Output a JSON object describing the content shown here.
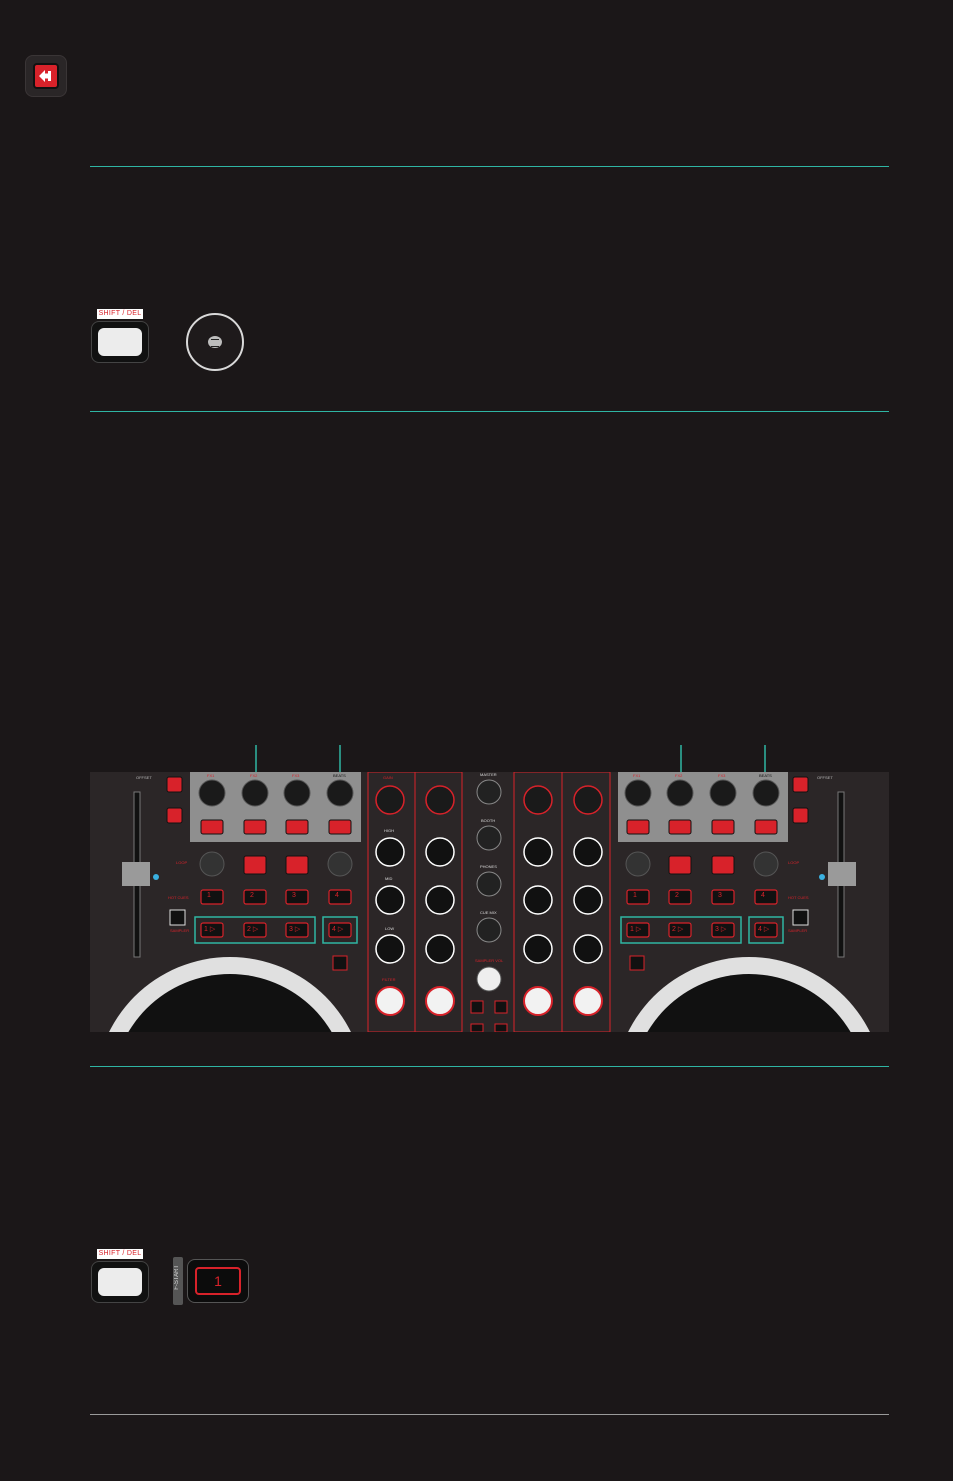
{
  "nav": {
    "back_icon": "back-arrow-icon"
  },
  "buttons": {
    "shift_label": "SHIFT / DEL",
    "browse_icon": "browse-knob-icon",
    "pad_label": "1",
    "pad_tag": "F-START"
  },
  "controller": {
    "left_deck": {
      "offset_label": "OFFSET",
      "loop_label": "LOOP",
      "hot_cues_label": "HOT CUES",
      "sampler_label": "SAMPLER",
      "fx_labels": [
        "FX1",
        "FX2",
        "FX3",
        "BEATS"
      ],
      "hot_cues": [
        "1",
        "2",
        "3",
        "4"
      ],
      "sampler_pads": [
        "1 ▷",
        "2 ▷",
        "3 ▷",
        "4 ▷"
      ]
    },
    "right_deck": {
      "offset_label": "OFFSET",
      "loop_label": "LOOP",
      "hot_cues_label": "HOT CUES",
      "sampler_label": "SAMPLER",
      "fx_labels": [
        "FX1",
        "FX2",
        "FX3",
        "BEATS"
      ],
      "hot_cues": [
        "1",
        "2",
        "3",
        "4"
      ],
      "sampler_pads": [
        "1 ▷",
        "2 ▷",
        "3 ▷",
        "4 ▷"
      ]
    },
    "mixer": {
      "channel_labels": [
        "GAIN",
        "HIGH",
        "MID",
        "LOW",
        "FILTER"
      ],
      "center_labels": [
        "MASTER",
        "BOOTH",
        "PHONES",
        "CUE MIX",
        "SAMPLER VOL"
      ]
    }
  },
  "colors": {
    "accent_red": "#d8222a",
    "teal": "#2fb5a3",
    "background": "#1b1718",
    "panel": "#2b2627"
  }
}
